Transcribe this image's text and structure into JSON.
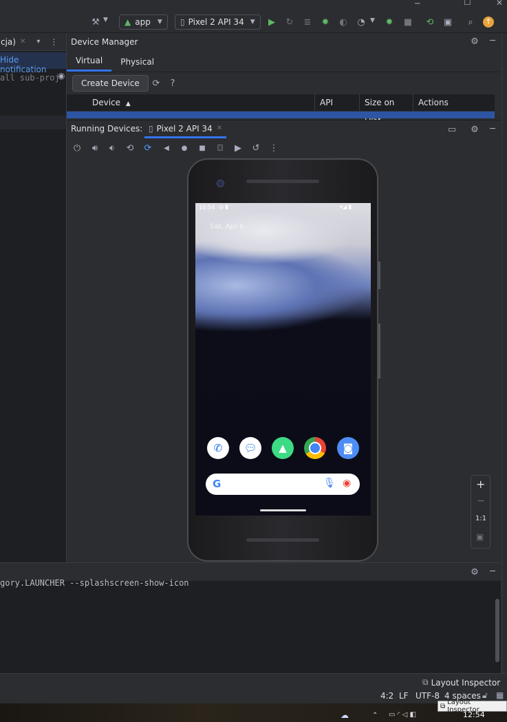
{
  "toolbar": {
    "run_config": "app",
    "device": "Pixel 2 API 34"
  },
  "left": {
    "tab_label": "cja)",
    "hide_notification": "Hide notification",
    "code_text": "all sub-proj"
  },
  "device_manager": {
    "title": "Device Manager",
    "tabs": [
      "Virtual",
      "Physical"
    ],
    "create_button": "Create Device",
    "columns": [
      "Device",
      "API",
      "Size on Disk",
      "Actions"
    ]
  },
  "running_devices": {
    "title": "Running Devices:",
    "tab": "Pixel 2 API 34"
  },
  "phone": {
    "time": "10:54",
    "date": "Sat, Apr 6"
  },
  "zoom": {
    "one_to_one": "1:1"
  },
  "terminal": {
    "line": "gory.LAUNCHER --splashscreen-show-icon"
  },
  "status": {
    "layout_inspector": "Layout Inspector",
    "position": "4:2",
    "line_sep": "LF",
    "encoding": "UTF-8",
    "indent": "4 spaces",
    "clock": "12:54",
    "layout_inspector_tooltip": "Layout Inspector"
  },
  "colors": {
    "accent": "#3574f0",
    "run_green": "#5fb865"
  }
}
